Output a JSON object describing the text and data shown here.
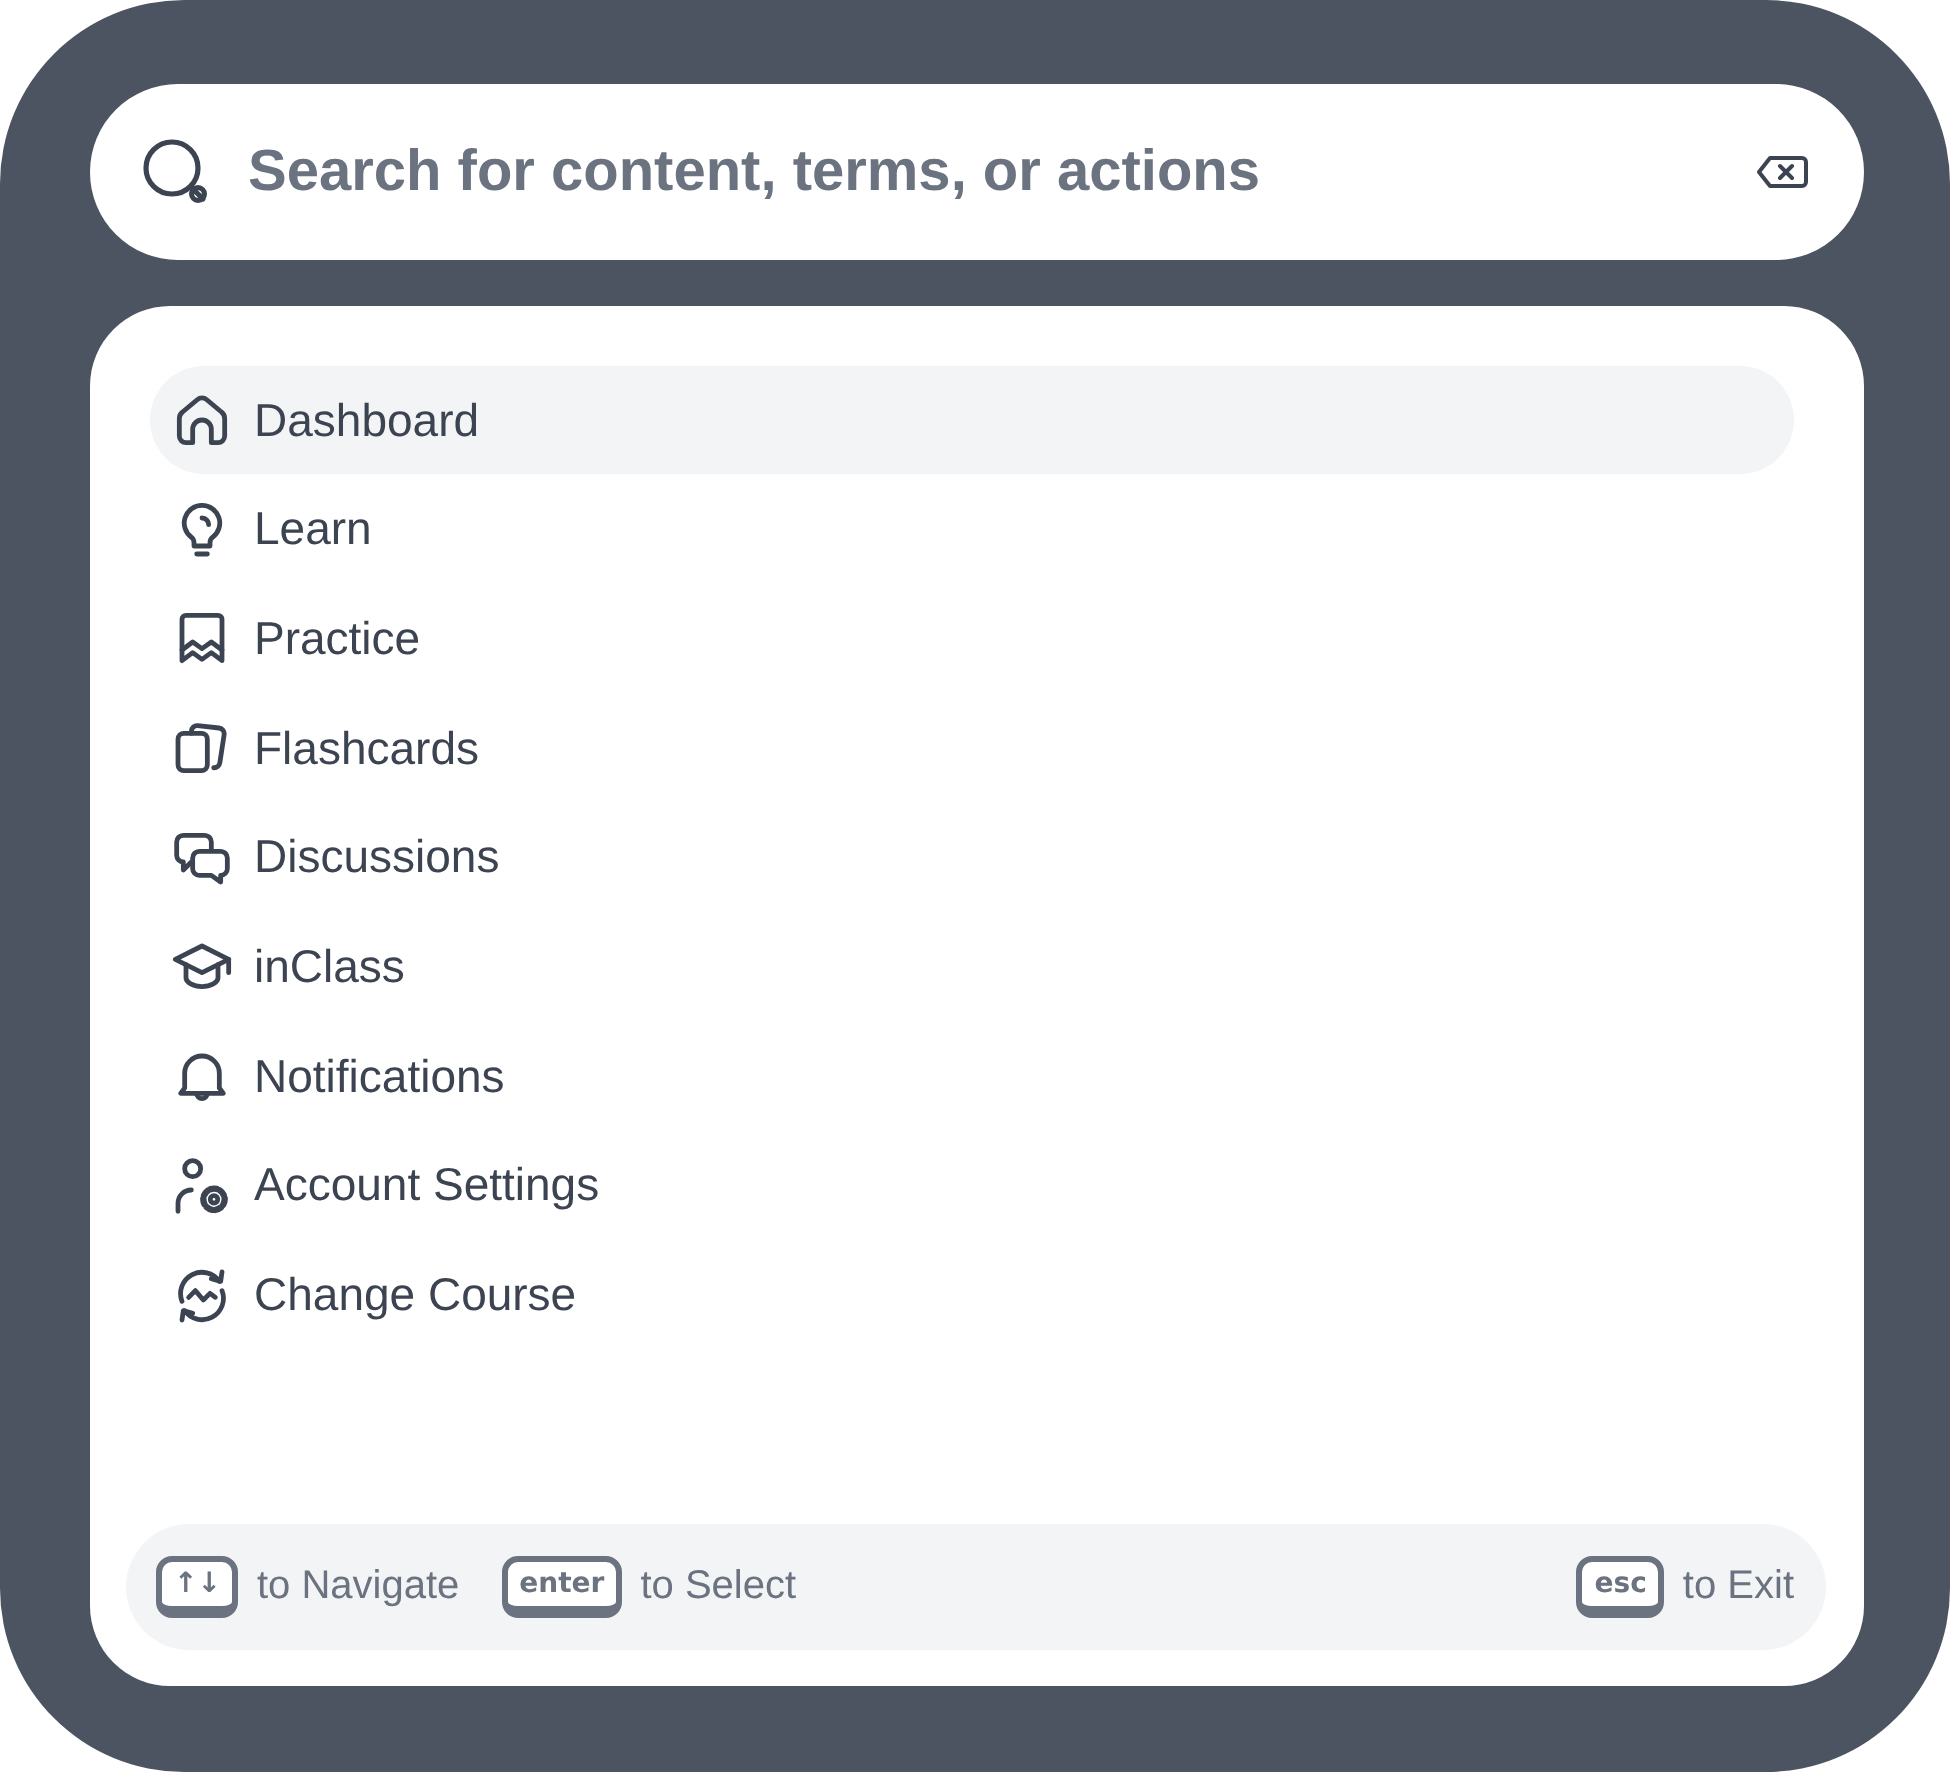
{
  "search": {
    "placeholder": "Search for content, terms, or actions"
  },
  "menu": {
    "items": [
      {
        "label": "Dashboard",
        "selected": true
      },
      {
        "label": "Learn",
        "selected": false
      },
      {
        "label": "Practice",
        "selected": false
      },
      {
        "label": "Flashcards",
        "selected": false
      },
      {
        "label": "Discussions",
        "selected": false
      },
      {
        "label": "inClass",
        "selected": false
      },
      {
        "label": "Notifications",
        "selected": false
      },
      {
        "label": "Account Settings",
        "selected": false
      },
      {
        "label": "Change Course",
        "selected": false
      }
    ]
  },
  "footer": {
    "left_hints": [
      {
        "key": "↑↓",
        "text": "to Navigate"
      },
      {
        "key": "enter",
        "text": "to Select"
      }
    ],
    "right_hints": [
      {
        "key": "esc",
        "text": "to Exit"
      }
    ]
  }
}
